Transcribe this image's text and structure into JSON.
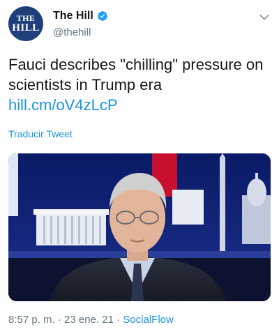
{
  "account": {
    "avatar_line1": "THE",
    "avatar_line2": "HILL",
    "name": "The Hill",
    "handle": "@thehill"
  },
  "icons": {
    "verified": "verified-badge-icon",
    "menu": "chevron-down-icon"
  },
  "tweet": {
    "text": "Fauci describes \"chilling\" pressure on scientists in Trump era ",
    "link": "hill.cm/oV4zLcP",
    "translate_label": "Traducir Tweet"
  },
  "meta": {
    "time": "8:57 p. m.",
    "separator": " · ",
    "date": "23 ene. 21",
    "source": "SocialFlow"
  },
  "colors": {
    "accent": "#1b95e0",
    "secondary_text": "#657786",
    "avatar_bg": "#1e3f7a"
  }
}
